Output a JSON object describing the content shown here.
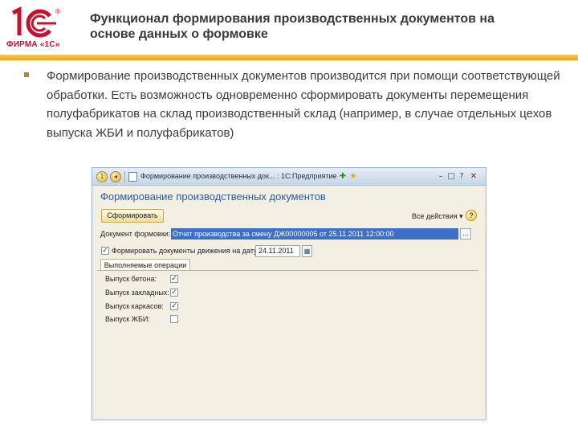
{
  "logo": {
    "mark": "1C",
    "reg": "®",
    "company": "ФИРМА «1С»",
    "color": "#c8102e"
  },
  "slide": {
    "title": "Функционал формирования производственных документов на основе данных о формовке",
    "bullet": "Формирование производственных документов производится при помощи соответствующей обработки. Есть возможность одновременно сформировать документы перемещения полуфабрикатов на склад производственный склад (например, в случае отдельных цехов выпуска ЖБИ и полуфабрикатов)"
  },
  "window": {
    "title": "Формирование производственных док... : 1С:Предприятие",
    "form_title": "Формирование производственных документов",
    "toolbar": {
      "form_button": "Сформировать",
      "all_actions": "Все действия ▾",
      "help": "?"
    },
    "document_row": {
      "label": "Документ формовки:",
      "value": "Отчет производства за смену ДЖ00000005 от 25.11.2011 12:00:00",
      "select_button": "..."
    },
    "movement_row": {
      "label": "Формировать документы движения на дату:",
      "checked": true,
      "date": "24.11.2011",
      "calendar_icon": "calendar-icon"
    },
    "tab": {
      "label": "Выполняемые операции"
    },
    "operations": [
      {
        "label": "Выпуск бетона:",
        "checked": true
      },
      {
        "label": "Выпуск закладных:",
        "checked": true
      },
      {
        "label": "Выпуск каркасов:",
        "checked": true
      },
      {
        "label": "Выпуск ЖБИ:",
        "checked": false
      }
    ],
    "colors": {
      "accent": "#2d5b97",
      "selection": "#3c6fc5",
      "header_rule": "#e6a817"
    }
  }
}
